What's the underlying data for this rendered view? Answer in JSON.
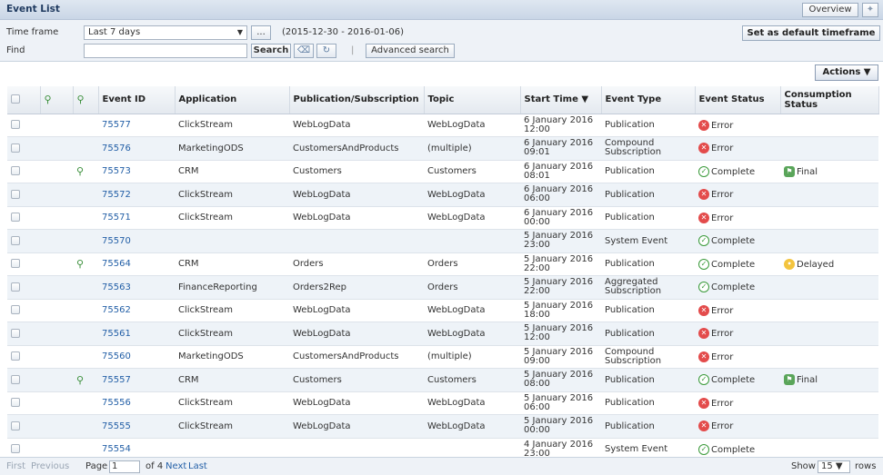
{
  "window": {
    "title": "Event List",
    "overview_label": "Overview"
  },
  "filter": {
    "timeframe_label": "Time frame",
    "timeframe_value": "Last 7 days",
    "ellipsis_label": "...",
    "date_range": "(2015-12-30 - 2016-01-06)",
    "set_default_label": "Set as default timeframe",
    "find_label": "Find",
    "find_value": "",
    "search_label": "Search",
    "advanced_label": "Advanced search"
  },
  "actions_label": "Actions ▼",
  "columns": {
    "event_id": "Event ID",
    "application": "Application",
    "pubsub": "Publication/Subscription",
    "topic": "Topic",
    "start_time": "Start Time ▼",
    "event_type": "Event Type",
    "event_status": "Event Status",
    "consumption_status": "Consumption Status"
  },
  "rows": [
    {
      "node": false,
      "id": "75577",
      "app": "ClickStream",
      "pubsub": "WebLogData",
      "topic": "WebLogData",
      "time1": "6 January 2016",
      "time2": "12:00",
      "type": "Publication",
      "status": "Error",
      "consumption": ""
    },
    {
      "node": false,
      "id": "75576",
      "app": "MarketingODS",
      "pubsub": "CustomersAndProducts",
      "topic": "(multiple)",
      "time1": "6 January 2016",
      "time2": "09:01",
      "type": "Compound Subscription",
      "status": "Error",
      "consumption": ""
    },
    {
      "node": true,
      "id": "75573",
      "app": "CRM",
      "pubsub": "Customers",
      "topic": "Customers",
      "time1": "6 January 2016",
      "time2": "08:01",
      "type": "Publication",
      "status": "Complete",
      "consumption": "Final"
    },
    {
      "node": false,
      "id": "75572",
      "app": "ClickStream",
      "pubsub": "WebLogData",
      "topic": "WebLogData",
      "time1": "6 January 2016",
      "time2": "06:00",
      "type": "Publication",
      "status": "Error",
      "consumption": ""
    },
    {
      "node": false,
      "id": "75571",
      "app": "ClickStream",
      "pubsub": "WebLogData",
      "topic": "WebLogData",
      "time1": "6 January 2016",
      "time2": "00:00",
      "type": "Publication",
      "status": "Error",
      "consumption": ""
    },
    {
      "node": false,
      "id": "75570",
      "app": "",
      "pubsub": "",
      "topic": "",
      "time1": "5 January 2016",
      "time2": "23:00",
      "type": "System Event",
      "status": "Complete",
      "consumption": ""
    },
    {
      "node": true,
      "id": "75564",
      "app": "CRM",
      "pubsub": "Orders",
      "topic": "Orders",
      "time1": "5 January 2016",
      "time2": "22:00",
      "type": "Publication",
      "status": "Complete",
      "consumption": "Delayed"
    },
    {
      "node": false,
      "id": "75563",
      "app": "FinanceReporting",
      "pubsub": "Orders2Rep",
      "topic": "Orders",
      "time1": "5 January 2016",
      "time2": "22:00",
      "type": "Aggregated Subscription",
      "status": "Complete",
      "consumption": ""
    },
    {
      "node": false,
      "id": "75562",
      "app": "ClickStream",
      "pubsub": "WebLogData",
      "topic": "WebLogData",
      "time1": "5 January 2016",
      "time2": "18:00",
      "type": "Publication",
      "status": "Error",
      "consumption": ""
    },
    {
      "node": false,
      "id": "75561",
      "app": "ClickStream",
      "pubsub": "WebLogData",
      "topic": "WebLogData",
      "time1": "5 January 2016",
      "time2": "12:00",
      "type": "Publication",
      "status": "Error",
      "consumption": ""
    },
    {
      "node": false,
      "id": "75560",
      "app": "MarketingODS",
      "pubsub": "CustomersAndProducts",
      "topic": "(multiple)",
      "time1": "5 January 2016",
      "time2": "09:00",
      "type": "Compound Subscription",
      "status": "Error",
      "consumption": ""
    },
    {
      "node": true,
      "id": "75557",
      "app": "CRM",
      "pubsub": "Customers",
      "topic": "Customers",
      "time1": "5 January 2016",
      "time2": "08:00",
      "type": "Publication",
      "status": "Complete",
      "consumption": "Final"
    },
    {
      "node": false,
      "id": "75556",
      "app": "ClickStream",
      "pubsub": "WebLogData",
      "topic": "WebLogData",
      "time1": "5 January 2016",
      "time2": "06:00",
      "type": "Publication",
      "status": "Error",
      "consumption": ""
    },
    {
      "node": false,
      "id": "75555",
      "app": "ClickStream",
      "pubsub": "WebLogData",
      "topic": "WebLogData",
      "time1": "5 January 2016",
      "time2": "00:00",
      "type": "Publication",
      "status": "Error",
      "consumption": ""
    },
    {
      "node": false,
      "id": "75554",
      "app": "",
      "pubsub": "",
      "topic": "",
      "time1": "4 January 2016",
      "time2": "23:00",
      "type": "System Event",
      "status": "Complete",
      "consumption": ""
    }
  ],
  "pager": {
    "first": "First",
    "previous": "Previous",
    "page_label": "Page",
    "page_value": "1",
    "of_label": "of 4",
    "next": "Next",
    "last": "Last",
    "show_label": "Show",
    "rows_value": "15 ▼",
    "rows_label": "rows"
  },
  "colors": {
    "link": "#2460a7",
    "error": "#e34b4b",
    "complete": "#3a9a3a",
    "delayed": "#f3c43e"
  }
}
